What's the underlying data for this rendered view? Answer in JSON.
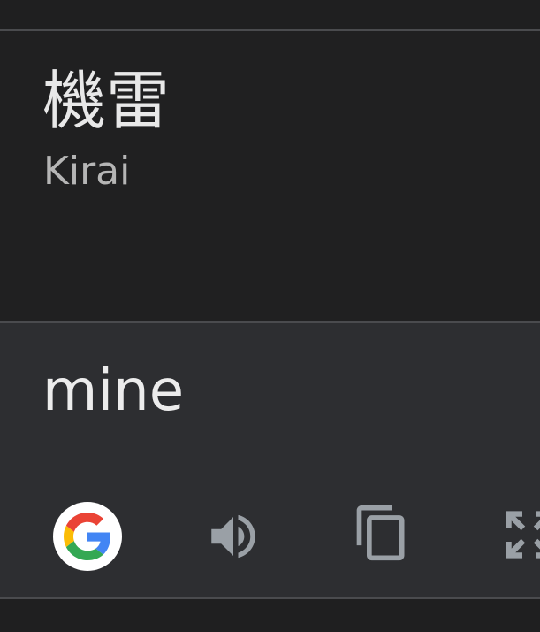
{
  "source": {
    "text": "機雷",
    "romanization": "Kirai"
  },
  "result": {
    "text": "mine"
  },
  "actions": [
    {
      "name": "google-search",
      "icon": "google-logo-icon"
    },
    {
      "name": "listen",
      "icon": "speaker-icon"
    },
    {
      "name": "copy",
      "icon": "copy-icon"
    },
    {
      "name": "fullscreen",
      "icon": "expand-icon"
    }
  ],
  "colors": {
    "background": "#1f1f20",
    "result_panel": "#2d2e31",
    "divider": "#4a4b4e",
    "icon_gray": "#9aa0a6",
    "google_blue": "#4285F4",
    "google_red": "#EA4335",
    "google_yellow": "#FBBC05",
    "google_green": "#34A853"
  }
}
